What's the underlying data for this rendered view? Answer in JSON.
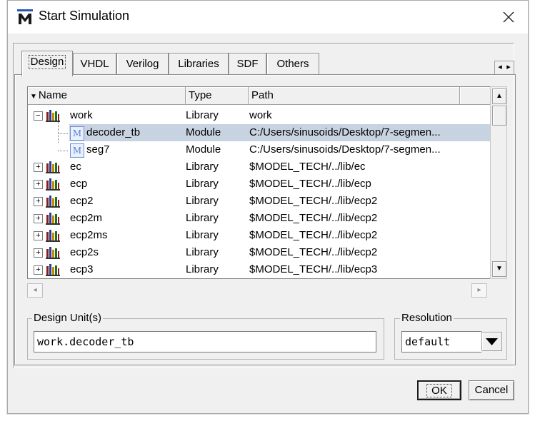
{
  "window": {
    "title": "Start Simulation"
  },
  "tabs": [
    "Design",
    "VHDL",
    "Verilog",
    "Libraries",
    "SDF",
    "Others"
  ],
  "tab_scroll": {
    "left": "◂",
    "right": "▸"
  },
  "columns": {
    "name": "Name",
    "type": "Type",
    "path": "Path"
  },
  "rows": [
    {
      "name": "work",
      "type": "Library",
      "path": "work",
      "expander": "−"
    },
    {
      "name": "decoder_tb",
      "type": "Module",
      "path": "C:/Users/sinusoids/Desktop/7-segmen..."
    },
    {
      "name": "seg7",
      "type": "Module",
      "path": "C:/Users/sinusoids/Desktop/7-segmen..."
    },
    {
      "name": "ec",
      "type": "Library",
      "path": "$MODEL_TECH/../lib/ec",
      "expander": "+"
    },
    {
      "name": "ecp",
      "type": "Library",
      "path": "$MODEL_TECH/../lib/ecp",
      "expander": "+"
    },
    {
      "name": "ecp2",
      "type": "Library",
      "path": "$MODEL_TECH/../lib/ecp2",
      "expander": "+"
    },
    {
      "name": "ecp2m",
      "type": "Library",
      "path": "$MODEL_TECH/../lib/ecp2",
      "expander": "+"
    },
    {
      "name": "ecp2ms",
      "type": "Library",
      "path": "$MODEL_TECH/../lib/ecp2",
      "expander": "+"
    },
    {
      "name": "ecp2s",
      "type": "Library",
      "path": "$MODEL_TECH/../lib/ecp2",
      "expander": "+"
    },
    {
      "name": "ecp3",
      "type": "Library",
      "path": "$MODEL_TECH/../lib/ecp3",
      "expander": "+"
    }
  ],
  "selected_row": 1,
  "design_unit": {
    "label": "Design Unit(s)",
    "value": "work.decoder_tb"
  },
  "resolution": {
    "label": "Resolution",
    "value": "default"
  },
  "buttons": {
    "ok": "OK",
    "cancel": "Cancel"
  },
  "colors": {
    "selection": "#c8d3e1",
    "library_icon": [
      "#8b1c1c",
      "#2a3f8f",
      "#c78a00",
      "#1d6b2a"
    ]
  }
}
